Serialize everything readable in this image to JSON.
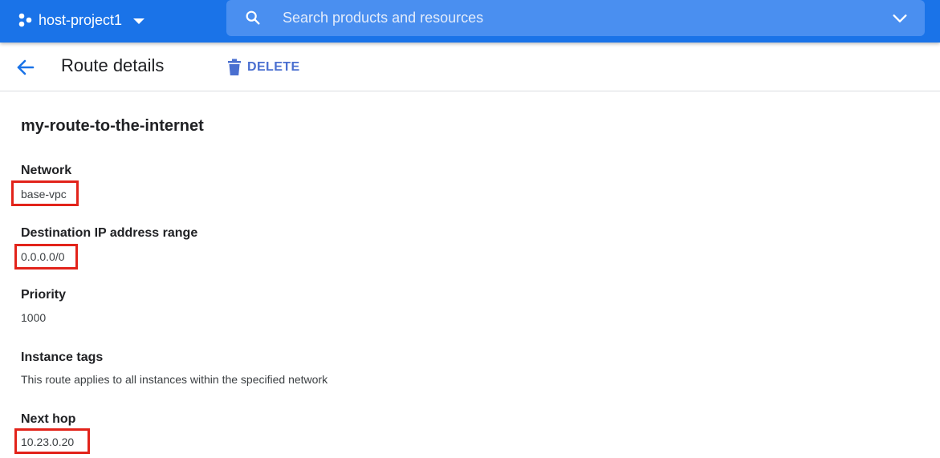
{
  "topbar": {
    "project_name": "host-project1",
    "search_placeholder": "Search products and resources"
  },
  "header": {
    "title": "Route details",
    "delete_label": "DELETE"
  },
  "route": {
    "name": "my-route-to-the-internet",
    "fields": [
      {
        "label": "Network",
        "value": "base-vpc"
      },
      {
        "label": "Destination IP address range",
        "value": "0.0.0.0/0"
      },
      {
        "label": "Priority",
        "value": "1000"
      },
      {
        "label": "Instance tags",
        "value": "This route applies to all instances within the specified network"
      },
      {
        "label": "Next hop",
        "value": "10.23.0.20"
      }
    ]
  },
  "colors": {
    "brand_blue": "#1a73e8",
    "search_bg": "#4a8ff0",
    "action_blue": "#4a6fd0",
    "highlight_red": "#e2231a"
  }
}
